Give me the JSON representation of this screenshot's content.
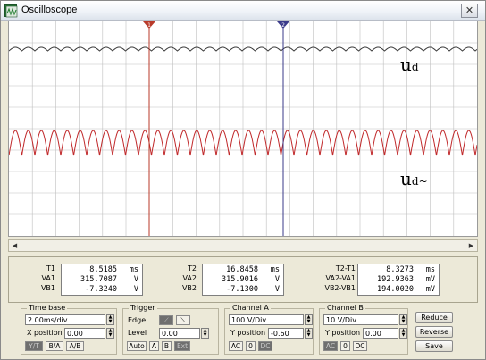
{
  "window": {
    "title": "Oscilloscope",
    "close_glyph": "✕"
  },
  "screen": {
    "grid": true,
    "background": "#ffffff",
    "grid_color": "#bfbfbf",
    "cursor1_color": "#b83a2a",
    "cursor2_color": "#3a3a8a",
    "trace_top_color": "#3a3a3a",
    "trace_bottom_color": "#c0282a",
    "labels": {
      "top": "u",
      "top_sub": "d",
      "bottom": "u",
      "bottom_sub": "d~"
    }
  },
  "readout": {
    "t1": {
      "label": "T1",
      "time": "8.5185",
      "time_unit": "ms",
      "va_label": "VA1",
      "va": "315.7087",
      "va_unit": "V",
      "vb_label": "VB1",
      "vb": "-7.3240",
      "vb_unit": "V"
    },
    "t2": {
      "label": "T2",
      "time": "16.8458",
      "time_unit": "ms",
      "va_label": "VA2",
      "va": "315.9016",
      "va_unit": "V",
      "vb_label": "VB2",
      "vb": "-7.1300",
      "vb_unit": "V"
    },
    "diff": {
      "label": "T2-T1",
      "time": "8.3273",
      "time_unit": "ms",
      "va_label": "VA2-VA1",
      "va": "192.9363",
      "va_unit": "mV",
      "vb_label": "VB2-VB1",
      "vb": "194.0020",
      "vb_unit": "mV"
    }
  },
  "timebase": {
    "title": "Time base",
    "scale": "2.00ms/div",
    "xpos_label": "X position",
    "xpos": "0.00",
    "modes": [
      "Y/T",
      "B/A",
      "A/B"
    ]
  },
  "trigger": {
    "title": "Trigger",
    "edge_label": "Edge",
    "edge_rise": "⟋",
    "edge_fall": "⟍",
    "level_label": "Level",
    "level": "0.00",
    "modes": [
      "Auto",
      "A",
      "B",
      "Ext"
    ]
  },
  "channel_a": {
    "title": "Channel A",
    "scale": "100 V/Div",
    "ypos_label": "Y position",
    "ypos": "-0.60",
    "coupling": [
      "AC",
      "0",
      "DC"
    ]
  },
  "channel_b": {
    "title": "Channel B",
    "scale": "10 V/Div",
    "ypos_label": "Y position",
    "ypos": "0.00",
    "coupling": [
      "AC",
      "0",
      "DC"
    ]
  },
  "buttons": {
    "reduce": "Reduce",
    "reverse": "Reverse",
    "save": "Save"
  }
}
